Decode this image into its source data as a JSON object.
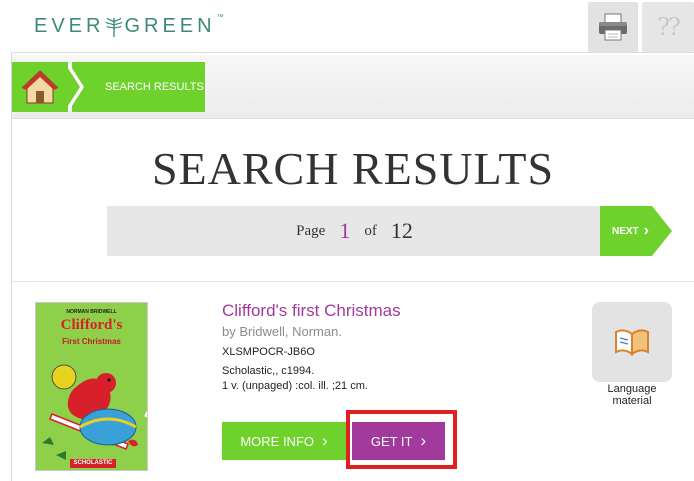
{
  "header": {
    "logo_text_left": "EVER",
    "logo_text_right": "GREEN",
    "logo_tm": "™",
    "print_icon": "printer-icon",
    "help_icon": "help-icon",
    "help_glyph": "?"
  },
  "breadcrumb": {
    "home_icon": "home-icon",
    "current": "SEARCH RESULTS"
  },
  "page_title": "SEARCH RESULTS",
  "pager": {
    "page_label": "Page",
    "current_page": "1",
    "of_label": "of",
    "total_pages": "12",
    "next_label": "NEXT",
    "next_chevron": "›"
  },
  "result": {
    "cover": {
      "author": "NORMAN BRIDWELL",
      "title": "Clifford's",
      "subtitle": "First Christmas",
      "publisher": "SCHOLASTIC"
    },
    "title": "Clifford's first Christmas",
    "author": "by Bridwell, Norman.",
    "call_number": "XLSMPOCR-JB6O",
    "publisher_line": "Scholastic,, c1994.",
    "description": "1 v. (unpaged) :col. ill. ;21 cm.",
    "more_info_label": "MORE INFO",
    "get_it_label": "GET IT",
    "chevron": "›",
    "format_icon": "book-icon",
    "format_label_line1": "Language",
    "format_label_line2": "material"
  },
  "colors": {
    "green": "#6fd12c",
    "purple": "#a23a9d",
    "highlight_red": "#e0201f",
    "logo_teal": "#3d8a78"
  }
}
